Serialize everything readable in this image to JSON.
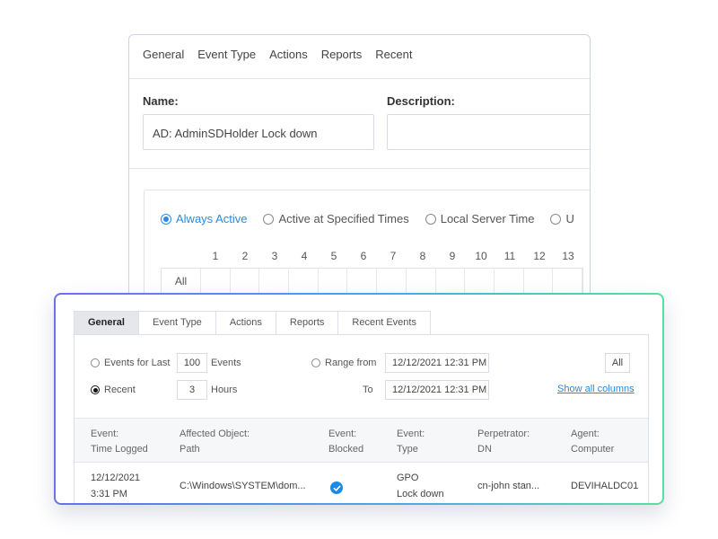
{
  "back": {
    "tabs": [
      "General",
      "Event Type",
      "Actions",
      "Reports",
      "Recent"
    ],
    "name_label": "Name:",
    "name_value": "AD: AdminSDHolder Lock down",
    "description_label": "Description:",
    "description_value": "",
    "schedule_options": [
      "Always Active",
      "Active at Specified Times",
      "Local Server Time",
      "U"
    ],
    "selected_schedule": "Always Active",
    "hours": [
      "1",
      "2",
      "3",
      "4",
      "5",
      "6",
      "7",
      "8",
      "9",
      "10",
      "11",
      "12",
      "13"
    ],
    "all_label": "All"
  },
  "front": {
    "tabs": [
      "General",
      "Event Type",
      "Actions",
      "Reports",
      "Recent Events"
    ],
    "active_tab": "General",
    "events_for_last_label": "Events for Last",
    "events_count": "100",
    "events_unit": "Events",
    "recent_label": "Recent",
    "recent_value": "3",
    "recent_unit": "Hours",
    "range_from_label": "Range from",
    "range_from_value": "12/12/2021 12:31 PM",
    "to_label": "To",
    "to_value": "12/12/2021 12:31 PM",
    "all_button": "All",
    "show_all_columns": "Show all columns",
    "columns": [
      {
        "line1": "Event:",
        "line2": "Time Logged"
      },
      {
        "line1": "Affected Object:",
        "line2": "Path"
      },
      {
        "line1": "Event:",
        "line2": "Blocked"
      },
      {
        "line1": "Event:",
        "line2": "Type"
      },
      {
        "line1": "Perpetrator:",
        "line2": "DN"
      },
      {
        "line1": "Agent:",
        "line2": "Computer"
      }
    ],
    "row": {
      "date": "12/12/2021",
      "time": "3:31 PM",
      "path": "C:\\Windows\\SYSTEM\\dom...",
      "blocked": true,
      "type_line1": "GPO",
      "type_line2": "Lock down",
      "perpetrator": "cn-john stan...",
      "computer": "DEVIHALDC01"
    }
  },
  "colors": {
    "accent": "#2b8ae0",
    "check": "#1e88e5"
  }
}
